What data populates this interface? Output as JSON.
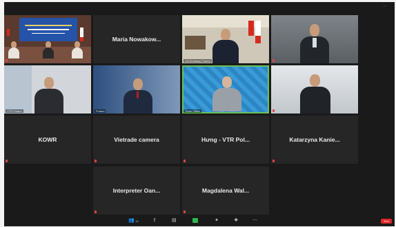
{
  "tiles": {
    "t1": {
      "caption": ""
    },
    "t2": {
      "name": "Maria  Nowakow..."
    },
    "t3": {
      "caption": "VN Embassy Poland"
    },
    "t4": {
      "caption": ""
    },
    "t5": {
      "caption": "VTR Poland"
    },
    "t6": {
      "caption": "Poland"
    },
    "t7": {
      "caption": "Trade Office"
    },
    "t8": {
      "caption": ""
    },
    "t9": {
      "name": "KOWR"
    },
    "t10": {
      "name": "Vietrade camera"
    },
    "t11": {
      "name": "Hưng - VTR Pol..."
    },
    "t12": {
      "name": "Katarzyna  Kanie..."
    },
    "t13": {
      "name": "Interpreter  Oan..."
    },
    "t14": {
      "name": "Magdalena  Wal..."
    }
  },
  "toolbar": {
    "participants_count": "13",
    "leave": "End"
  },
  "colors": {
    "active_speaker": "#6ac259",
    "leave": "#e02828"
  }
}
